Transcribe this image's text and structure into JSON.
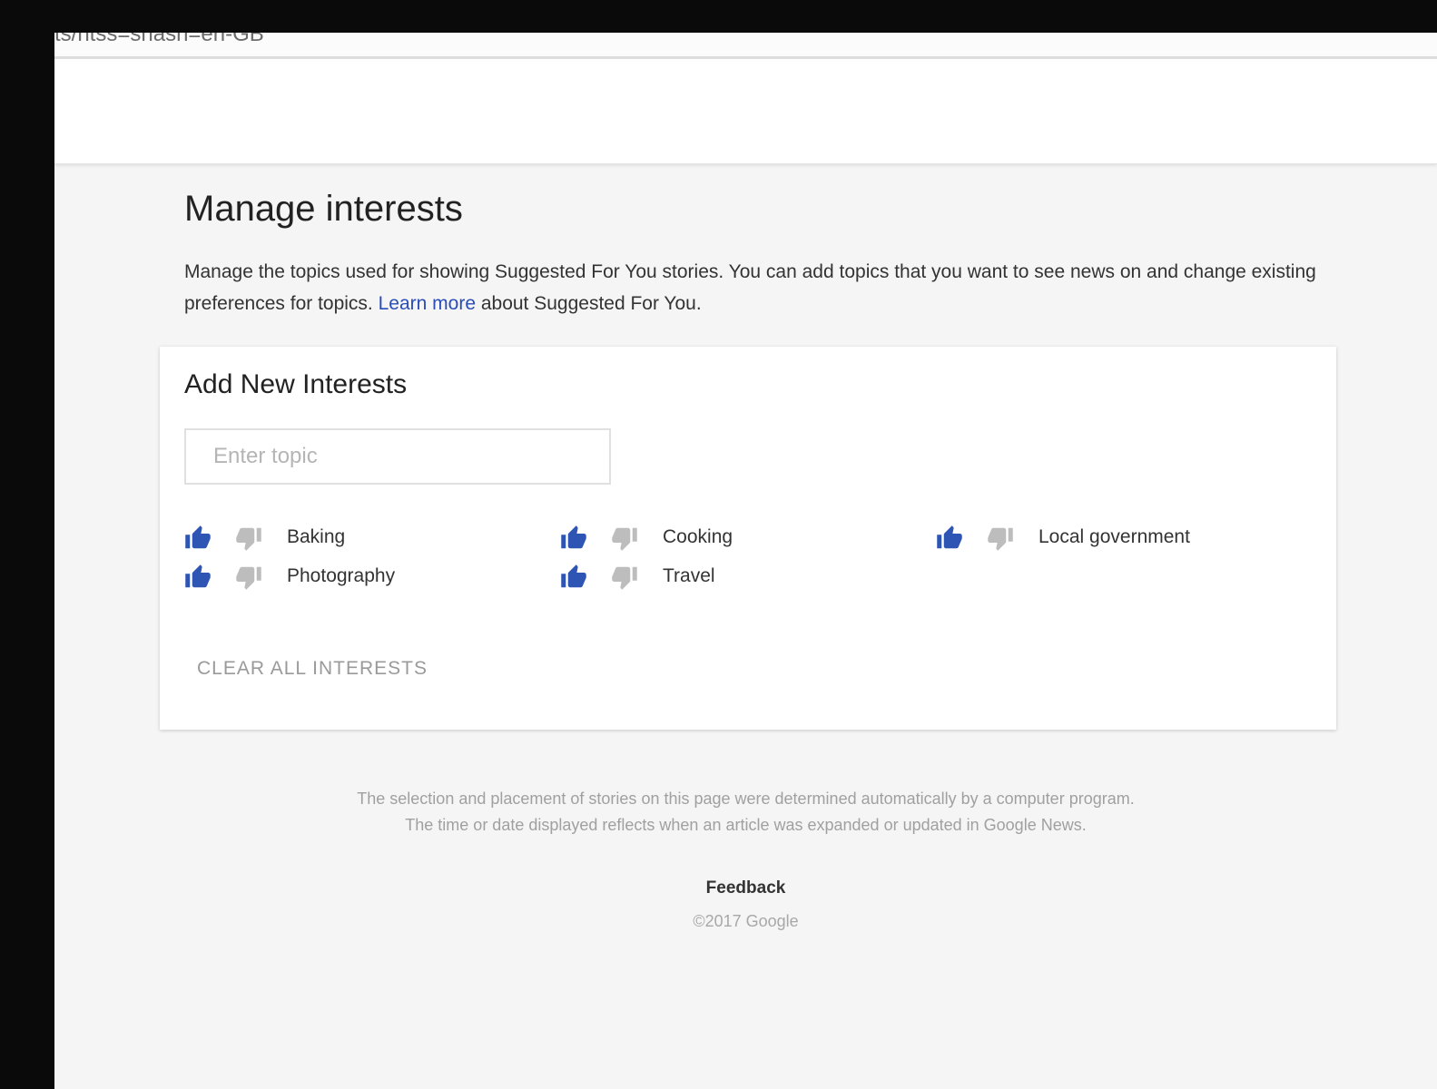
{
  "browser": {
    "url_fragment": "ts/ntss=shash=en-GB"
  },
  "page": {
    "title": "Manage interests",
    "description_before_link": "Manage the topics used for showing Suggested For You stories. You can add topics that you want to see news on and change existing preferences for topics. ",
    "learn_more_link": "Learn more",
    "description_after_link": " about Suggested For You."
  },
  "add_interests": {
    "title": "Add New Interests",
    "input_placeholder": "Enter topic",
    "input_value": "",
    "clear_all_label": "CLEAR ALL INTERESTS"
  },
  "topics": [
    {
      "label": "Baking",
      "preference": "liked"
    },
    {
      "label": "Cooking",
      "preference": "liked"
    },
    {
      "label": "Local government",
      "preference": "liked"
    },
    {
      "label": "Photography",
      "preference": "liked"
    },
    {
      "label": "Travel",
      "preference": "liked"
    }
  ],
  "colors": {
    "liked": "#2f55b4",
    "neutral": "#bdbdbd",
    "link": "#2a4db7"
  },
  "footer": {
    "note_line1": "The selection and placement of stories on this page were determined automatically by a computer program.",
    "note_line2": "The time or date displayed reflects when an article was expanded or updated in Google News.",
    "feedback": "Feedback",
    "copyright": "©2017 Google"
  }
}
